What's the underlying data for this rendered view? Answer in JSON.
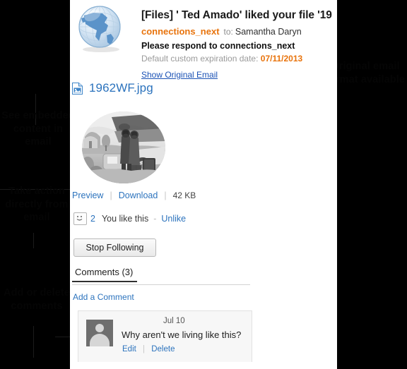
{
  "header": {
    "globe_icon": "globe-icon",
    "title": "[Files] ' Ted Amado' liked your file '19",
    "sender": "connections_next",
    "to_label": "to:",
    "recipient": "Samantha Daryn",
    "respond_line": "Please respond to connections_next",
    "expiration_label": "Default custom expiration date:",
    "expiration_date": "07/11/2013",
    "show_original_link": "Show Original Email"
  },
  "attachment": {
    "file_icon": "image-file-icon",
    "filename": "1962WF.jpg",
    "thumbnail_alt": "vintage photo of two men by a car",
    "preview_label": "Preview",
    "download_label": "Download",
    "size": "42 KB"
  },
  "like": {
    "smiley_icon": "smiley-icon",
    "count": "2",
    "status_text": "You like this",
    "separator": "-",
    "unlike_label": "Unlike"
  },
  "follow": {
    "button_label": "Stop Following"
  },
  "comments": {
    "tab_label": "Comments (3)",
    "add_label": "Add a Comment",
    "items": [
      {
        "date": "Jul 10",
        "text": "Why aren't we living like this?",
        "edit_label": "Edit",
        "delete_label": "Delete",
        "avatar_icon": "user-avatar-icon"
      }
    ]
  },
  "annotations": {
    "embedded": "See embedded\ncontent in email",
    "take_action": "Take action\ndirectly from\nemail",
    "add_delete": "Add or delete\ncomments",
    "original_format": "Original email\nformat available"
  },
  "colors": {
    "accent_orange": "#e8730c",
    "link_blue": "#2c73bd",
    "header_link_blue": "#1b52b5",
    "background_black": "#000000",
    "panel_white": "#ffffff"
  }
}
